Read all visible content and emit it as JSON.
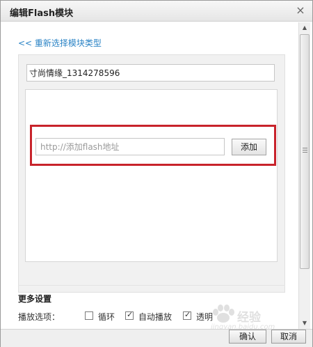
{
  "dialog": {
    "title": "编辑Flash模块",
    "close_glyph": "×"
  },
  "content": {
    "back_link": "<< 重新选择模块类型",
    "module_name_value": "寸尚情缘_1314278596",
    "url_placeholder": "http://添加flash地址",
    "add_button": "添加",
    "highlight_color": "#c8232b"
  },
  "more_settings": {
    "title": "更多设置",
    "play_label": "播放选项：",
    "options": [
      {
        "label": "循环",
        "checked": false
      },
      {
        "label": "自动播放",
        "checked": true
      },
      {
        "label": "透明",
        "checked": true
      }
    ]
  },
  "footer": {
    "ok_button": "确认",
    "cancel_button": "取消"
  },
  "watermark": {
    "brand": "经验",
    "url": "jingyan.baidu.com"
  }
}
